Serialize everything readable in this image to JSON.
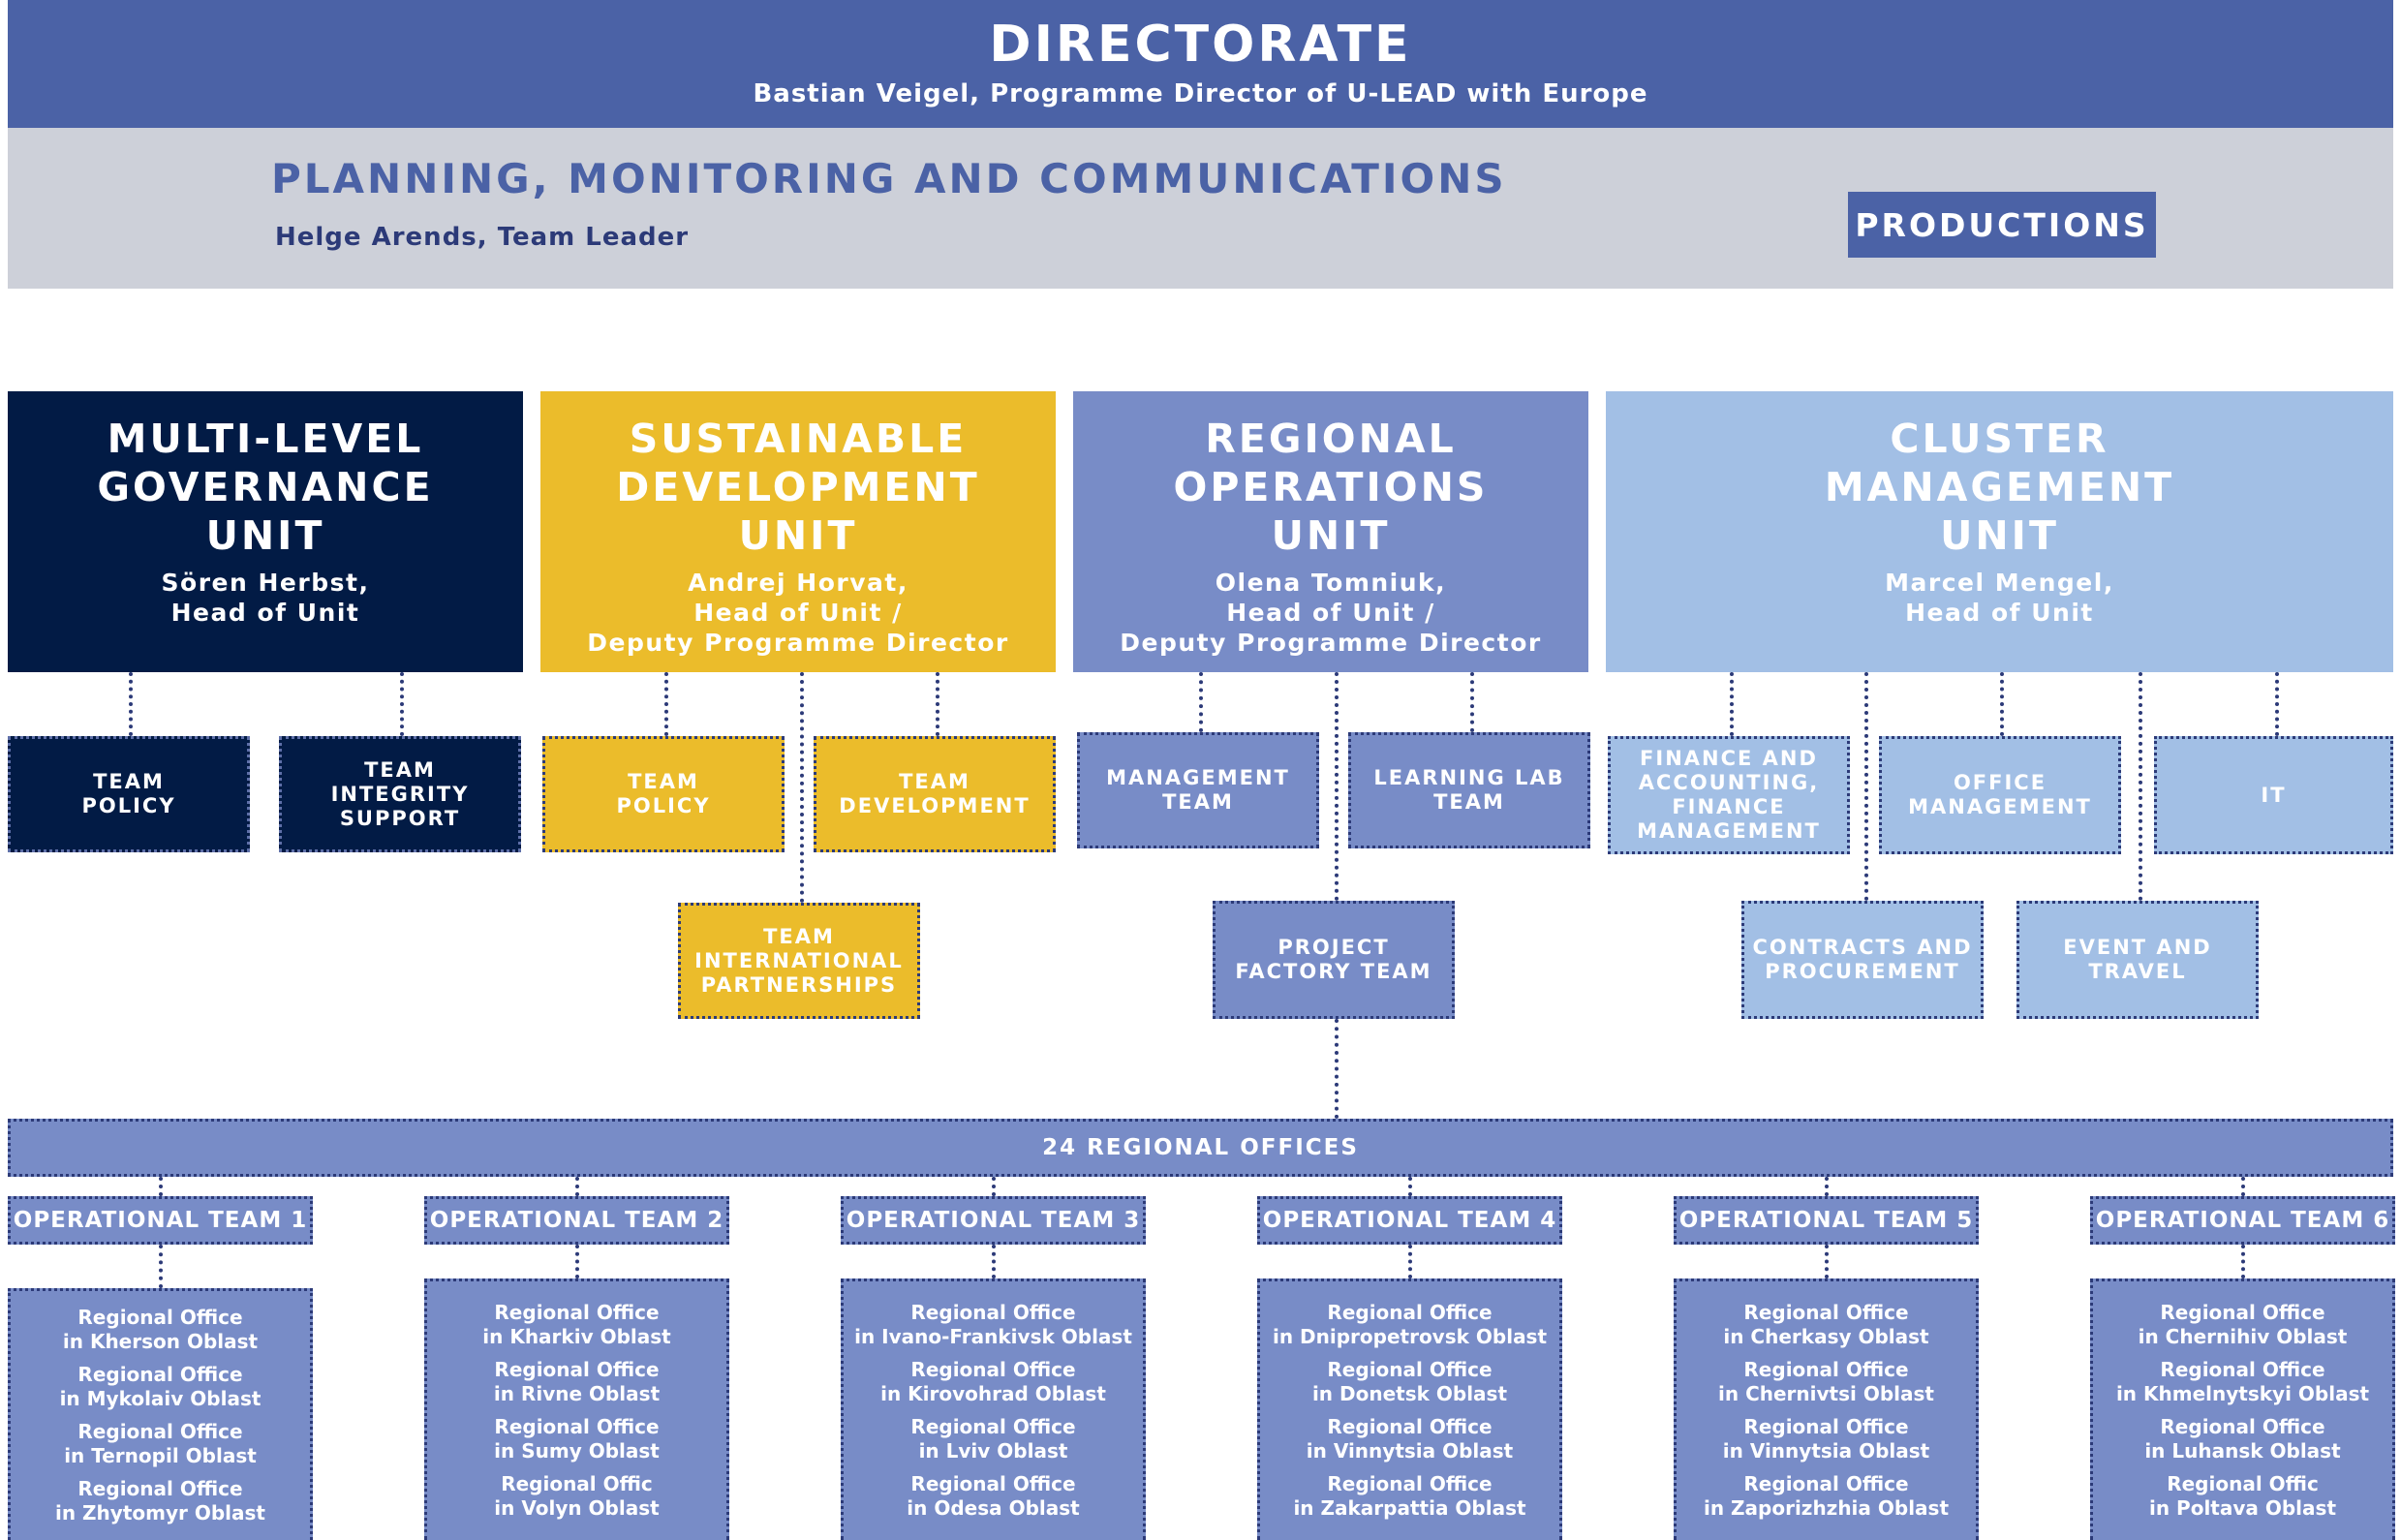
{
  "directorate": {
    "title": "DIRECTORATE",
    "subtitle": "Bastian Veigel, Programme Director of U-LEAD with Europe"
  },
  "pmc": {
    "title": "PLANNING, MONITORING AND COMMUNICATIONS",
    "leader": "Helge Arends, Team Leader",
    "productions": "PRODUCTIONS"
  },
  "units": [
    {
      "title": "MULTI-LEVEL GOVERNANCE UNIT",
      "head": "Sören Herbst, Head of Unit",
      "title_lines": [
        "MULTI-LEVEL",
        "GOVERNANCE",
        "UNIT"
      ],
      "head_lines": [
        "Sören Herbst,",
        "Head of Unit"
      ]
    },
    {
      "title": "SUSTAINABLE DEVELOPMENT UNIT",
      "head": "Andrej Horvat, Head of Unit / Deputy Programme Director",
      "title_lines": [
        "SUSTAINABLE",
        "DEVELOPMENT",
        "UNIT"
      ],
      "head_lines": [
        "Andrej Horvat,",
        "Head of Unit /",
        "Deputy Programme Director"
      ]
    },
    {
      "title": "REGIONAL OPERATIONS UNIT",
      "head": "Olena Tomniuk, Head of Unit / Deputy Programme Director",
      "title_lines": [
        "REGIONAL",
        "OPERATIONS",
        "UNIT"
      ],
      "head_lines": [
        "Olena Tomniuk,",
        "Head of Unit /",
        "Deputy Programme Director"
      ]
    },
    {
      "title": "CLUSTER MANAGEMENT UNIT",
      "head": "Marcel Mengel, Head of Unit",
      "title_lines": [
        "CLUSTER",
        "MANAGEMENT",
        "UNIT"
      ],
      "head_lines": [
        "Marcel Mengel,",
        "Head of Unit"
      ]
    }
  ],
  "teams": {
    "mlg_policy": [
      "TEAM",
      "POLICY"
    ],
    "mlg_integrity": [
      "TEAM",
      "INTEGRITY",
      "SUPPORT"
    ],
    "sd_policy": [
      "TEAM",
      "POLICY"
    ],
    "sd_development": [
      "TEAM",
      "DEVELOPMENT"
    ],
    "sd_international": [
      "TEAM",
      "INTERNATIONAL",
      "PARTNERSHIPS"
    ],
    "ro_management": [
      "MANAGEMENT",
      "TEAM"
    ],
    "ro_learning": [
      "LEARNING LAB",
      "TEAM"
    ],
    "ro_project": [
      "PROJECT",
      "FACTORY TEAM"
    ],
    "cm_finance": [
      "FINANCE AND",
      "ACCOUNTING,",
      "FINANCE",
      "MANAGEMENT"
    ],
    "cm_office": [
      "OFFICE",
      "MANAGEMENT"
    ],
    "cm_it": [
      "IT"
    ],
    "cm_contracts": [
      "CONTRACTS AND",
      "PROCUREMENT"
    ],
    "cm_event": [
      "EVENT AND",
      "TRAVEL"
    ]
  },
  "regional": {
    "label": "24 REGIONAL OFFICES",
    "teams": [
      {
        "name": "OPERATIONAL TEAM 1",
        "offices": [
          [
            "Regional Office",
            "in Kherson Oblast"
          ],
          [
            "Regional Office",
            "in Mykolaiv Oblast"
          ],
          [
            "Regional Office",
            "in Ternopil Oblast"
          ],
          [
            "Regional Office",
            "in Zhytomyr Oblast"
          ]
        ]
      },
      {
        "name": "OPERATIONAL TEAM 2",
        "offices": [
          [
            "Regional Office",
            "in Kharkiv Oblast"
          ],
          [
            "Regional Office",
            "in Rivne Oblast"
          ],
          [
            "Regional Office",
            "in Sumy Oblast"
          ],
          [
            "Regional Offic",
            "in Volyn Oblast"
          ]
        ]
      },
      {
        "name": "OPERATIONAL TEAM 3",
        "offices": [
          [
            "Regional Office",
            "in Ivano-Frankivsk Oblast"
          ],
          [
            "Regional Office",
            "in Kirovohrad Oblast"
          ],
          [
            "Regional Office",
            "in Lviv Oblast"
          ],
          [
            "Regional Office",
            "in Odesa Oblast"
          ]
        ]
      },
      {
        "name": "OPERATIONAL TEAM 4",
        "offices": [
          [
            "Regional Office",
            "in Dnipropetrovsk Oblast"
          ],
          [
            "Regional Office",
            "in Donetsk Oblast"
          ],
          [
            "Regional Office",
            "in Vinnytsia Oblast"
          ],
          [
            "Regional Office",
            "in Zakarpattia Oblast"
          ]
        ]
      },
      {
        "name": "OPERATIONAL TEAM 5",
        "offices": [
          [
            "Regional Office",
            "in Cherkasy Oblast"
          ],
          [
            "Regional Office",
            "in Chernivtsi Oblast"
          ],
          [
            "Regional Office",
            "in Vinnytsia Oblast"
          ],
          [
            "Regional Office",
            "in Zaporizhzhia Oblast"
          ]
        ]
      },
      {
        "name": "OPERATIONAL TEAM 6",
        "offices": [
          [
            "Regional Office",
            "in Chernihiv Oblast"
          ],
          [
            "Regional Office",
            "in Khmelnytskyi Oblast"
          ],
          [
            "Regional Office",
            "in Luhansk Oblast"
          ],
          [
            "Regional Offic",
            "in Poltava Oblast"
          ]
        ]
      }
    ]
  },
  "colors": {
    "directorate": "#4b62a6",
    "pmc_background": "#cdd0d9",
    "multi_level_governance": "#021b45",
    "sustainable_development": "#ebbc2b",
    "regional_operations": "#788cc7",
    "cluster_management": "#a2bfe5",
    "dotted_connector": "#2c3a78"
  }
}
